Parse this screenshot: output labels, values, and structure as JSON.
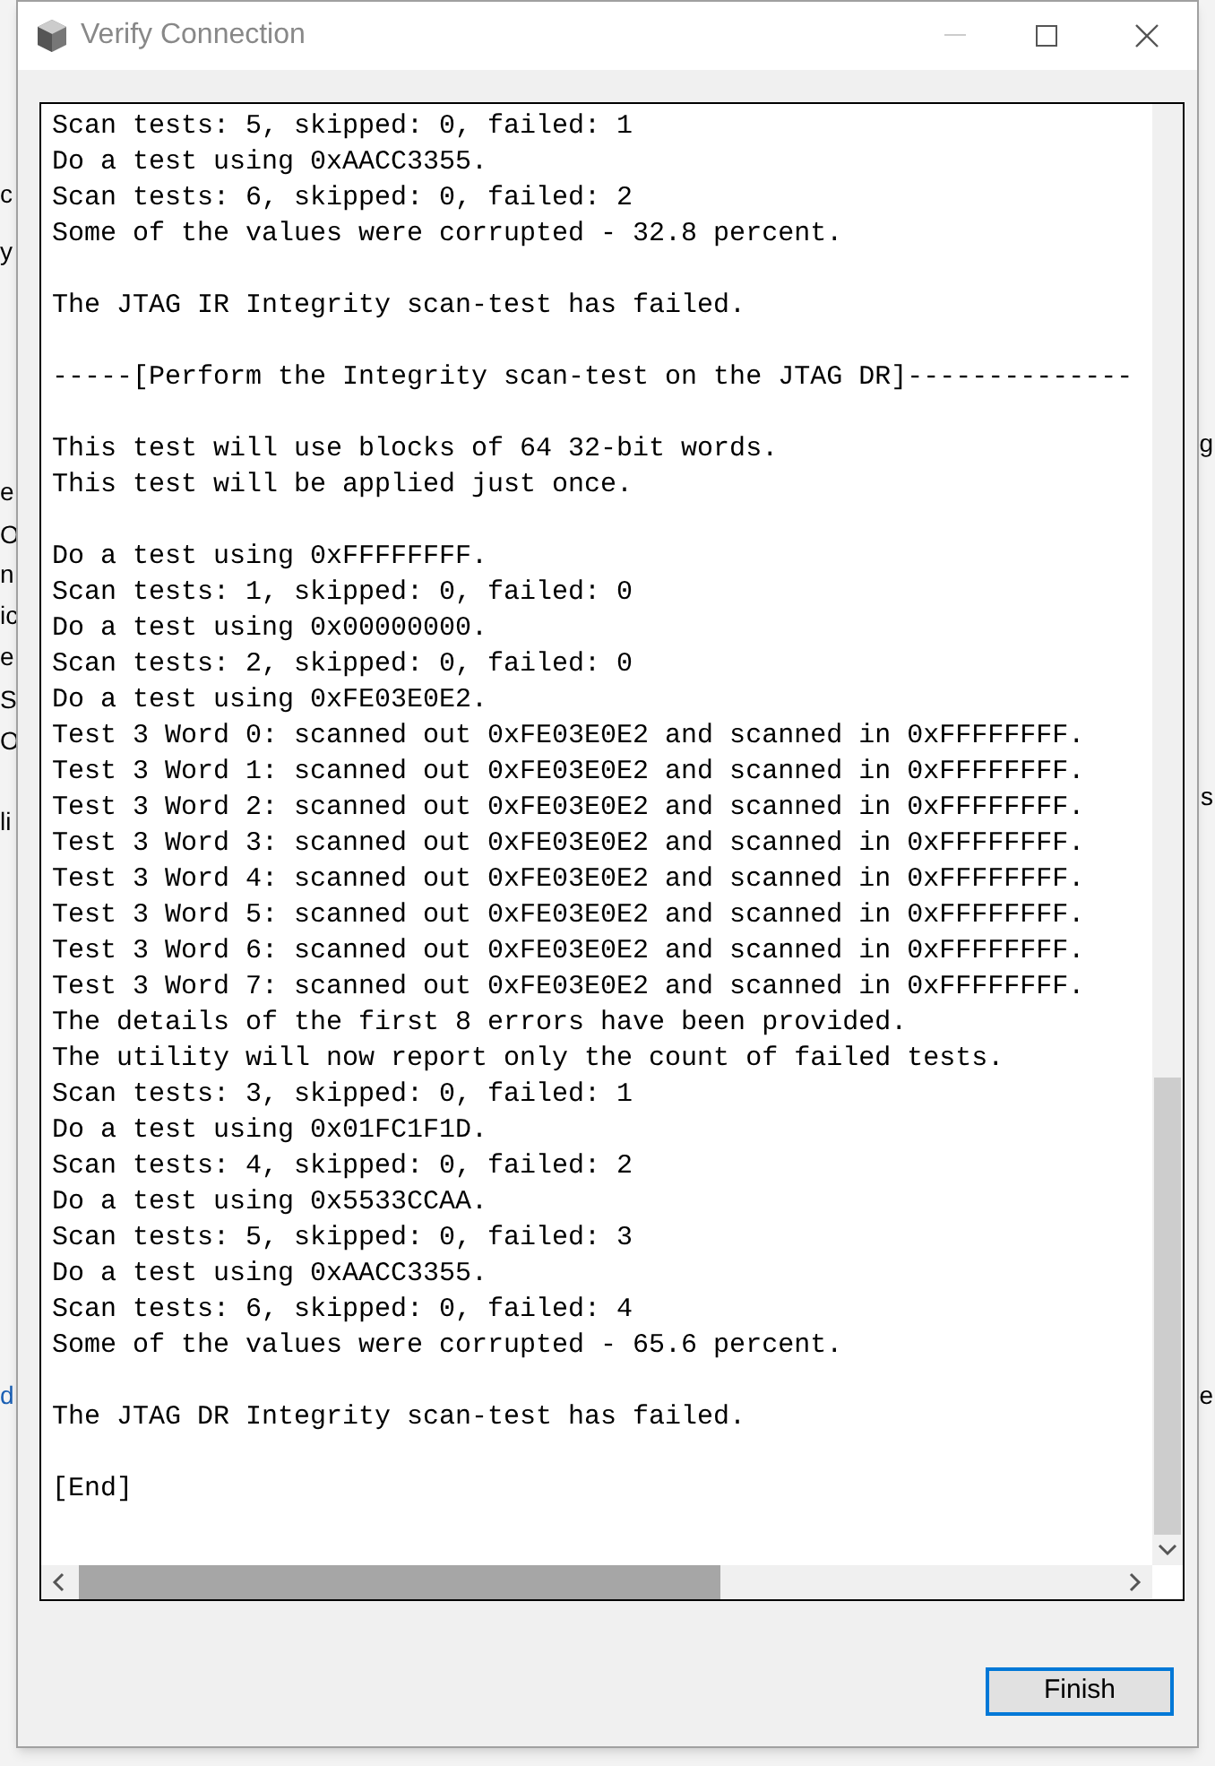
{
  "background_fragments": {
    "left": [
      "c",
      "y",
      "e",
      "O",
      "n",
      "ic",
      "e",
      "S",
      "O",
      "li",
      "d"
    ],
    "right": [
      "g",
      "s",
      "e"
    ]
  },
  "window": {
    "title": "Verify Connection"
  },
  "log": {
    "paragraphs": [
      [
        "Scan tests: 5, skipped: 0, failed: 1",
        "Do a test using 0xAACC3355.",
        "Scan tests: 6, skipped: 0, failed: 2",
        "Some of the values were corrupted - 32.8 percent."
      ],
      [
        "The JTAG IR Integrity scan-test has failed."
      ],
      [
        "-----[Perform the Integrity scan-test on the JTAG DR]--------------"
      ],
      [
        "This test will use blocks of 64 32-bit words.",
        "This test will be applied just once."
      ],
      [
        "Do a test using 0xFFFFFFFF.",
        "Scan tests: 1, skipped: 0, failed: 0",
        "Do a test using 0x00000000.",
        "Scan tests: 2, skipped: 0, failed: 0",
        "Do a test using 0xFE03E0E2.",
        "Test 3 Word 0: scanned out 0xFE03E0E2 and scanned in 0xFFFFFFFF.",
        "Test 3 Word 1: scanned out 0xFE03E0E2 and scanned in 0xFFFFFFFF.",
        "Test 3 Word 2: scanned out 0xFE03E0E2 and scanned in 0xFFFFFFFF.",
        "Test 3 Word 3: scanned out 0xFE03E0E2 and scanned in 0xFFFFFFFF.",
        "Test 3 Word 4: scanned out 0xFE03E0E2 and scanned in 0xFFFFFFFF.",
        "Test 3 Word 5: scanned out 0xFE03E0E2 and scanned in 0xFFFFFFFF.",
        "Test 3 Word 6: scanned out 0xFE03E0E2 and scanned in 0xFFFFFFFF.",
        "Test 3 Word 7: scanned out 0xFE03E0E2 and scanned in 0xFFFFFFFF.",
        "The details of the first 8 errors have been provided.",
        "The utility will now report only the count of failed tests.",
        "Scan tests: 3, skipped: 0, failed: 1",
        "Do a test using 0x01FC1F1D.",
        "Scan tests: 4, skipped: 0, failed: 2",
        "Do a test using 0x5533CCAA.",
        "Scan tests: 5, skipped: 0, failed: 3",
        "Do a test using 0xAACC3355.",
        "Scan tests: 6, skipped: 0, failed: 4",
        "Some of the values were corrupted - 65.6 percent."
      ],
      [
        "The JTAG DR Integrity scan-test has failed."
      ],
      [
        "[End]"
      ]
    ]
  },
  "buttons": {
    "finish": "Finish"
  }
}
